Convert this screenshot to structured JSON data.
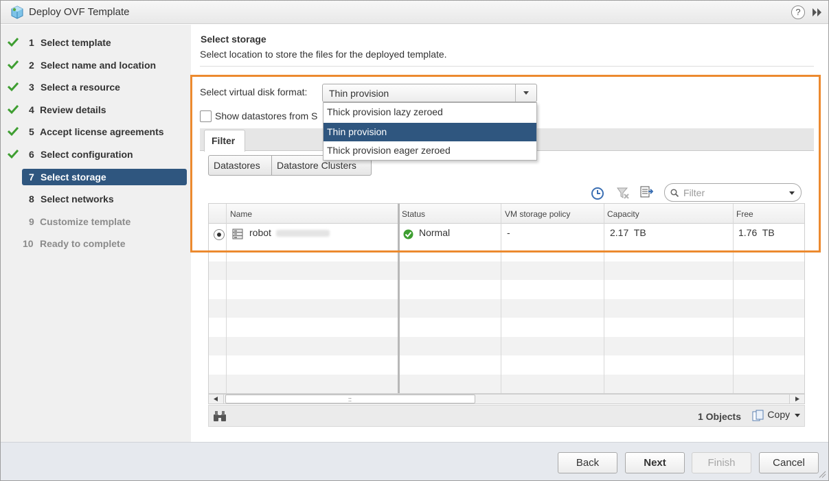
{
  "window": {
    "title": "Deploy OVF Template",
    "help": "?"
  },
  "colors": {
    "accent": "#2f567f",
    "highlight_box": "#ec8a2f",
    "check": "#3e9e31"
  },
  "nav": [
    {
      "num": "1",
      "label": "Select template",
      "done": true
    },
    {
      "num": "2",
      "label": "Select name and location",
      "done": true
    },
    {
      "num": "3",
      "label": "Select a resource",
      "done": true
    },
    {
      "num": "4",
      "label": "Review details",
      "done": true
    },
    {
      "num": "5",
      "label": "Accept license agreements",
      "done": true
    },
    {
      "num": "6",
      "label": "Select configuration",
      "done": true
    },
    {
      "num": "7",
      "label": "Select storage",
      "active": true
    },
    {
      "num": "8",
      "label": "Select networks"
    },
    {
      "num": "9",
      "label": "Customize template",
      "disabled": true
    },
    {
      "num": "10",
      "label": "Ready to complete",
      "disabled": true
    }
  ],
  "main": {
    "title": "Select storage",
    "subtitle": "Select location to store the files for the deployed template.",
    "disk_format_label": "Select virtual disk format:",
    "disk_format_value": "Thin provision",
    "disk_format_options": [
      "Thick provision lazy zeroed",
      "Thin provision",
      "Thick provision eager zeroed"
    ],
    "show_datastores_label": "Show datastores from S",
    "filter_tab": "Filter",
    "seg_buttons": [
      "Datastores",
      "Datastore Clusters"
    ],
    "filter_placeholder": "Filter"
  },
  "table": {
    "columns": [
      "Name",
      "Status",
      "VM storage policy",
      "Capacity",
      "Free"
    ],
    "rows": [
      {
        "name": "robot",
        "status": "Normal",
        "policy": "-",
        "capacity": "2.17  TB",
        "free": "1.76  TB"
      }
    ]
  },
  "footer": {
    "objects": "1 Objects",
    "copy": "Copy",
    "scroll_grip": "::"
  },
  "buttons": {
    "back": "Back",
    "next": "Next",
    "finish": "Finish",
    "cancel": "Cancel"
  }
}
